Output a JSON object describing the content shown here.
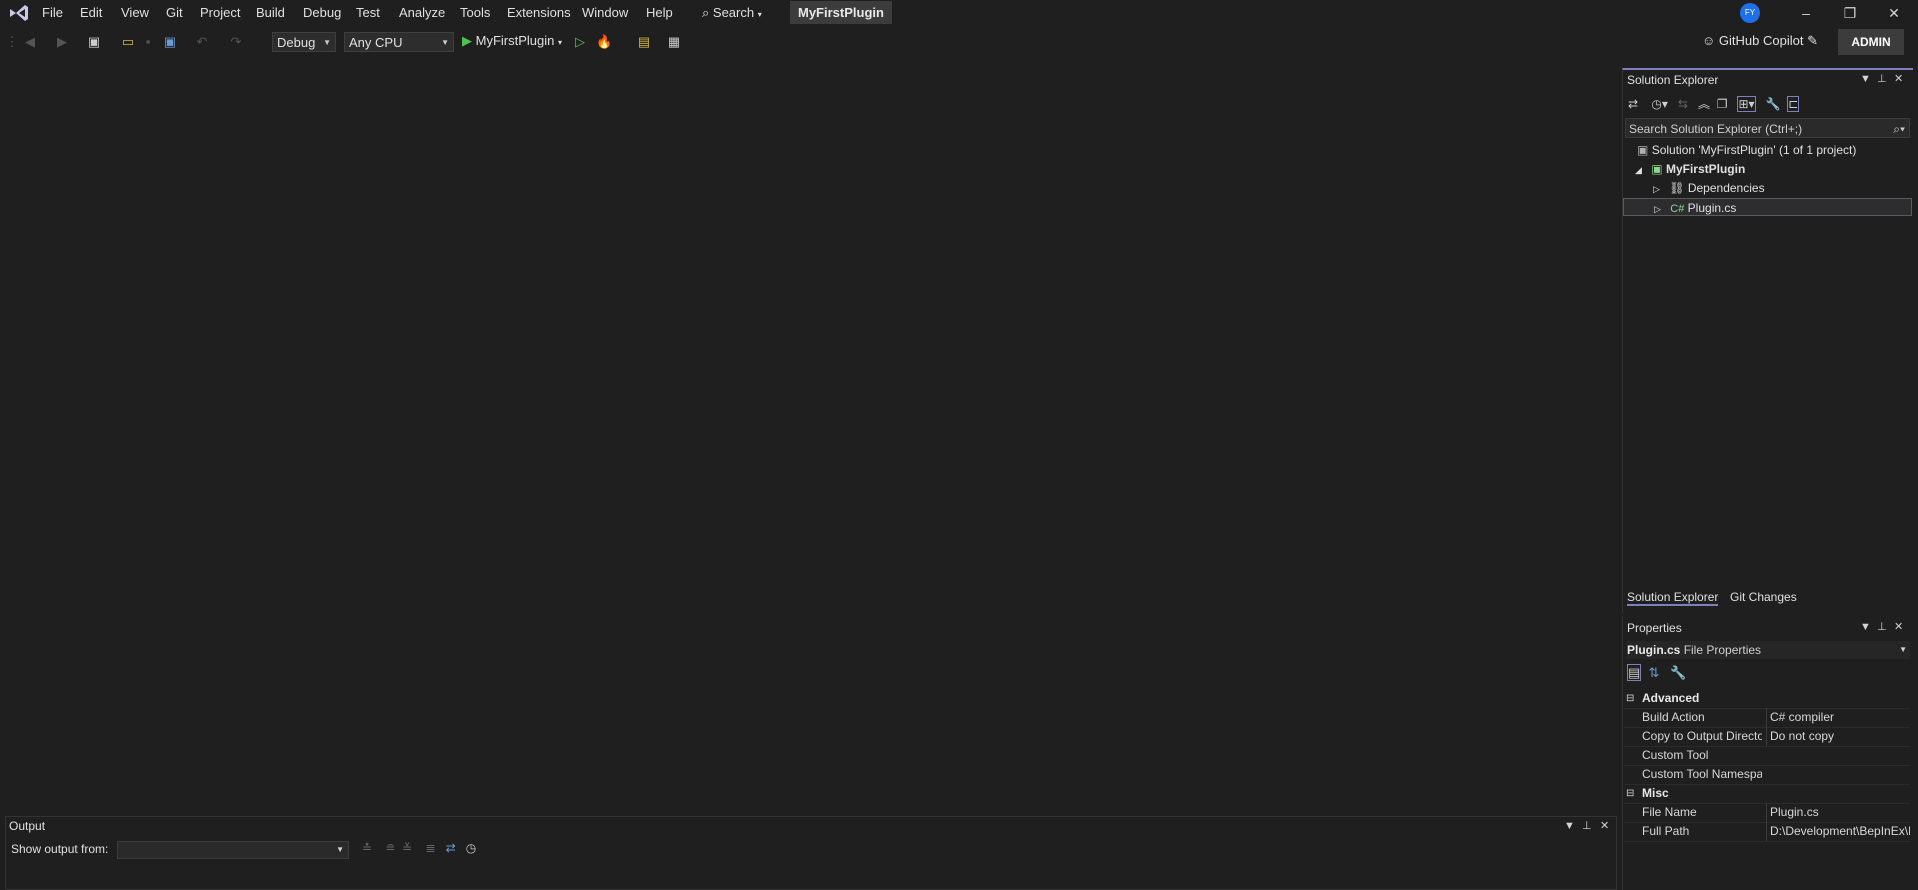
{
  "menubar": {
    "items": [
      "File",
      "Edit",
      "View",
      "Git",
      "Project",
      "Build",
      "Debug",
      "Test",
      "Analyze",
      "Tools",
      "Extensions",
      "Window",
      "Help"
    ],
    "search_label": "Search",
    "project_name": "MyFirstPlugin",
    "avatar_initials": "FY"
  },
  "toolbar": {
    "configuration": "Debug",
    "platform": "Any CPU",
    "startup_project": "MyFirstPlugin",
    "copilot_label": "GitHub Copilot",
    "admin_label": "ADMIN"
  },
  "solution_explorer": {
    "title": "Solution Explorer",
    "search_placeholder": "Search Solution Explorer (Ctrl+;)",
    "tree": {
      "solution": "Solution 'MyFirstPlugin' (1 of 1 project)",
      "project": "MyFirstPlugin",
      "dependencies": "Dependencies",
      "file": "Plugin.cs"
    },
    "tabs": [
      "Solution Explorer",
      "Git Changes"
    ]
  },
  "properties": {
    "title": "Properties",
    "object_name": "Plugin.cs",
    "object_type": "File Properties",
    "categories": [
      {
        "name": "Advanced",
        "rows": [
          {
            "key": "Build Action",
            "value": "C# compiler"
          },
          {
            "key": "Copy to Output Directo",
            "value": "Do not copy"
          },
          {
            "key": "Custom Tool",
            "value": ""
          },
          {
            "key": "Custom Tool Namespa",
            "value": ""
          }
        ]
      },
      {
        "name": "Misc",
        "rows": [
          {
            "key": "File Name",
            "value": "Plugin.cs"
          },
          {
            "key": "Full Path",
            "value": "D:\\Development\\BepInEx\\P"
          }
        ]
      }
    ]
  },
  "output": {
    "title": "Output",
    "show_from_label": "Show output from:"
  },
  "colors": {
    "background": "#1f1f1f",
    "accent": "#7f7fbf",
    "run": "#4ec24e",
    "avatar": "#1f6feb"
  }
}
